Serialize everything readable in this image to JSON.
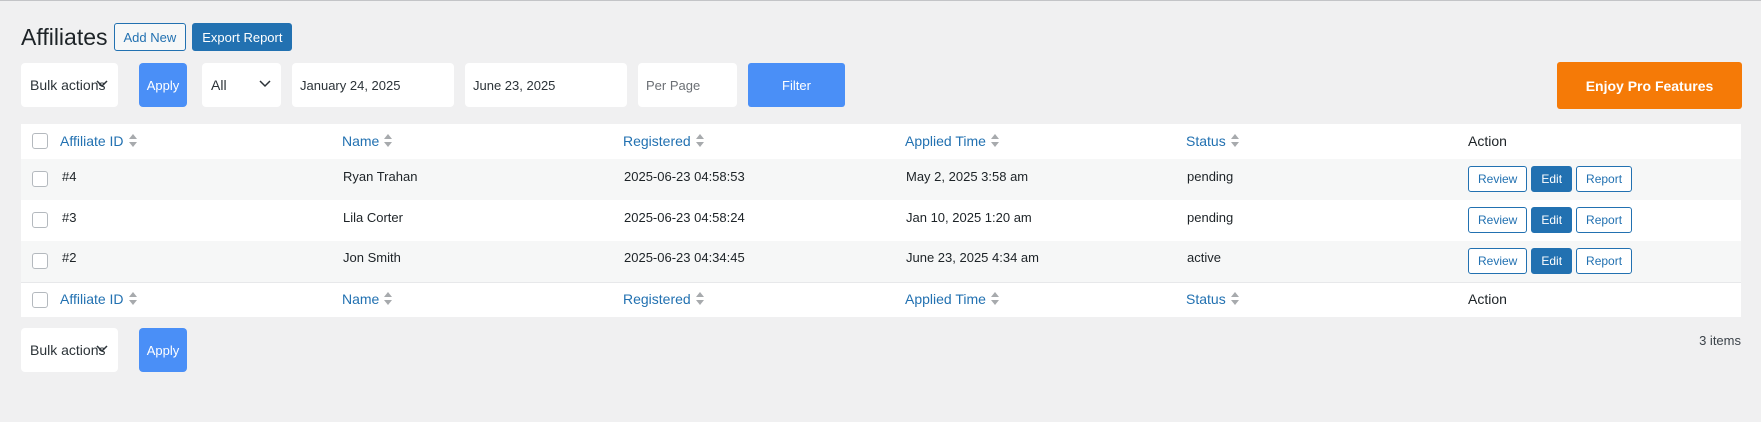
{
  "header": {
    "title": "Affiliates",
    "add_new": "Add New",
    "export_report": "Export Report"
  },
  "toolbar": {
    "bulk_actions": "Bulk actions",
    "apply": "Apply",
    "status_filter": "All",
    "start_date": "January 24, 2025",
    "end_date": "June 23, 2025",
    "per_page_placeholder": "Per Page",
    "filter": "Filter",
    "pro": "Enjoy Pro Features"
  },
  "table": {
    "columns": [
      "Affiliate ID",
      "Name",
      "Registered",
      "Applied Time",
      "Status",
      "Action"
    ],
    "rows": [
      {
        "id": "#4",
        "name": "Ryan Trahan",
        "registered": "2025-06-23 04:58:53",
        "applied": "May 2, 2025 3:58 am",
        "status": "pending"
      },
      {
        "id": "#3",
        "name": "Lila Corter",
        "registered": "2025-06-23 04:58:24",
        "applied": "Jan 10, 2025 1:20 am",
        "status": "pending"
      },
      {
        "id": "#2",
        "name": "Jon Smith",
        "registered": "2025-06-23 04:34:45",
        "applied": "June 23, 2025 4:34 am",
        "status": "active"
      }
    ],
    "actions": {
      "review": "Review",
      "edit": "Edit",
      "report": "Report"
    }
  },
  "bottom": {
    "bulk_actions": "Bulk actions",
    "apply": "Apply",
    "item_count": "3 items"
  },
  "colors": {
    "accent": "#2271b1",
    "button_blue": "#4a8ff7",
    "pro_orange": "#f57a07"
  }
}
